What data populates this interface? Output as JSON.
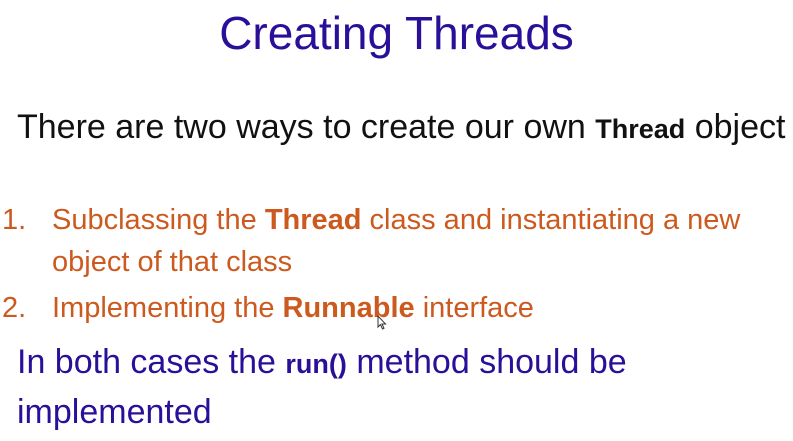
{
  "title": "Creating Threads",
  "intro": {
    "text_before": "There are two ways to create our own ",
    "bold": "Thread",
    "text_after": " object"
  },
  "list": [
    {
      "number": "1.",
      "before": "Subclassing the ",
      "bold": "Thread",
      "after": " class and instantiating a new object of that class"
    },
    {
      "number": "2.",
      "before": "Implementing the ",
      "bold": "Runnable",
      "after": " interface"
    }
  ],
  "outro": {
    "text_before": "In both cases the ",
    "bold": "run()",
    "text_after": " method should be implemented"
  },
  "colors": {
    "title": "#2a0f98",
    "list": "#cc5a1e",
    "body": "#111111"
  }
}
